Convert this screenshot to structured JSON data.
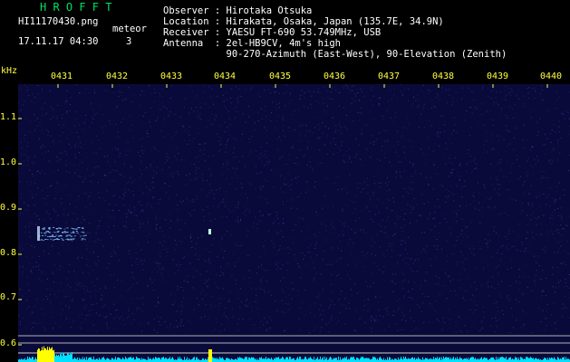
{
  "header": {
    "brand": "H R O F F T",
    "filename": "HI11170430.png",
    "datetime": "17.11.17 04:30",
    "meteor_label": "meteor",
    "meteor_count": "3",
    "info_lines": [
      "Observer : Hirotaka Otsuka",
      "Location : Hirakata, Osaka, Japan (135.7E, 34.9N)",
      "Receiver : YAESU FT-690 53.749MHz, USB",
      "Antenna  : 2el-HB9CV, 4m's high",
      "           90-270-Azimuth (East-West), 90-Elevation (Zenith)"
    ]
  },
  "axes": {
    "y_unit": "kHz",
    "x_ticks": [
      "0431",
      "0432",
      "0433",
      "0434",
      "0435",
      "0436",
      "0437",
      "0438",
      "0439",
      "0440"
    ],
    "y_ticks": [
      "1.1",
      "1.0",
      "0.9",
      "0.8",
      "0.7",
      "0.6"
    ],
    "tick_color": "#ffff40"
  },
  "colors": {
    "background": "#000000",
    "plot_background": "#0a0a3a",
    "noise": "#3a3aa0",
    "echo": "#80c0ff",
    "spectrum_strong": "#ffff00",
    "spectrum_weak": "#00e0ff"
  },
  "echoes": [
    {
      "minute": "0431",
      "freq_khz": 0.85,
      "type": "streak"
    },
    {
      "minute": "0434",
      "freq_khz": 0.85,
      "type": "point"
    }
  ]
}
